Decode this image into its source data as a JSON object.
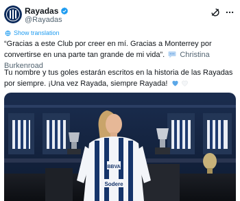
{
  "account": {
    "name": "Rayadas",
    "handle": "@Rayadas"
  },
  "translate_label": "Show translation",
  "post": {
    "quote": "“Gracias a este Club por creer en mí. Gracias a Monterrey por convertirse en una parte tan grande de mi vida”.",
    "author": "Christina Burkenroad",
    "body": "Tu nombre y tus goles estarán escritos en la historia de las Rayadas por siempre. ¡Una vez Rayada, siempre Rayada!"
  },
  "jersey": {
    "sponsor_top": "BBVA",
    "sponsor_bottom": "Sodere"
  },
  "icons": {
    "verified": "verified-badge-icon",
    "grok": "grok-icon",
    "more": "more-icon",
    "translate": "globe-icon",
    "speech": "speech-balloon-icon",
    "hearts": [
      "blue-heart-icon",
      "white-heart-icon"
    ]
  },
  "colors": {
    "brand_blue": "#1d9bf0",
    "secondary_text": "#536471",
    "heart_blue": "#5aa7e8"
  }
}
